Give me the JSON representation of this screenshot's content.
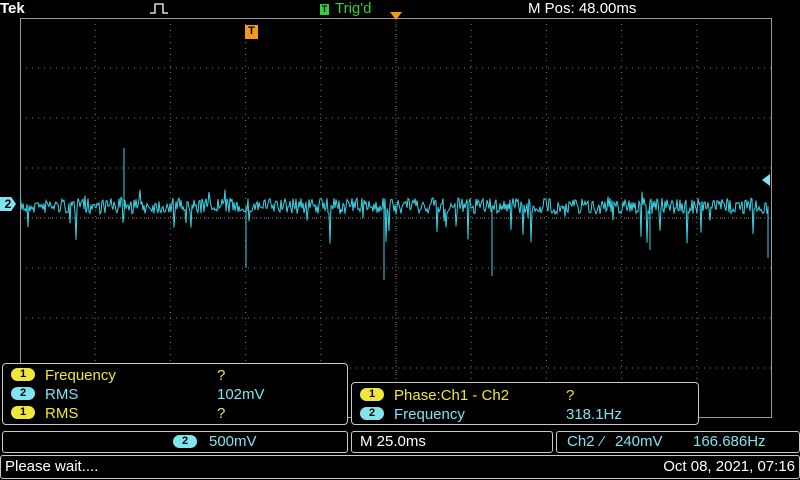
{
  "header": {
    "brand": "Tek",
    "trigger_state": "Trig'd",
    "trigger_badge": "T",
    "m_pos": "M Pos: 48.00ms"
  },
  "screen": {
    "channel_marker": "2",
    "trigger_marker": "T",
    "colors": {
      "ch1": "#f2e63a",
      "ch2": "#7fe4ee",
      "trigger": "#f29a1c",
      "trig_state": "#36d13a"
    }
  },
  "measurements_left": [
    {
      "ch": "1",
      "label": "Frequency",
      "value": "?"
    },
    {
      "ch": "2",
      "label": "RMS",
      "value": "102mV"
    },
    {
      "ch": "1",
      "label": "RMS",
      "value": "?"
    }
  ],
  "measurements_right": [
    {
      "ch": "1",
      "label": "Phase:Ch1 - Ch2",
      "value": "?"
    },
    {
      "ch": "2",
      "label": "Frequency",
      "value": "318.1Hz"
    }
  ],
  "scale_bar": {
    "ch2_num": "2",
    "ch2_scale": "500mV",
    "timebase": "M 25.0ms",
    "trigger_source": "Ch2",
    "trigger_slope": "⁄",
    "trigger_level": "240mV",
    "trigger_freq": "166.686Hz"
  },
  "status": {
    "message": "Please wait....",
    "datetime": "Oct 08, 2021, 07:16"
  }
}
